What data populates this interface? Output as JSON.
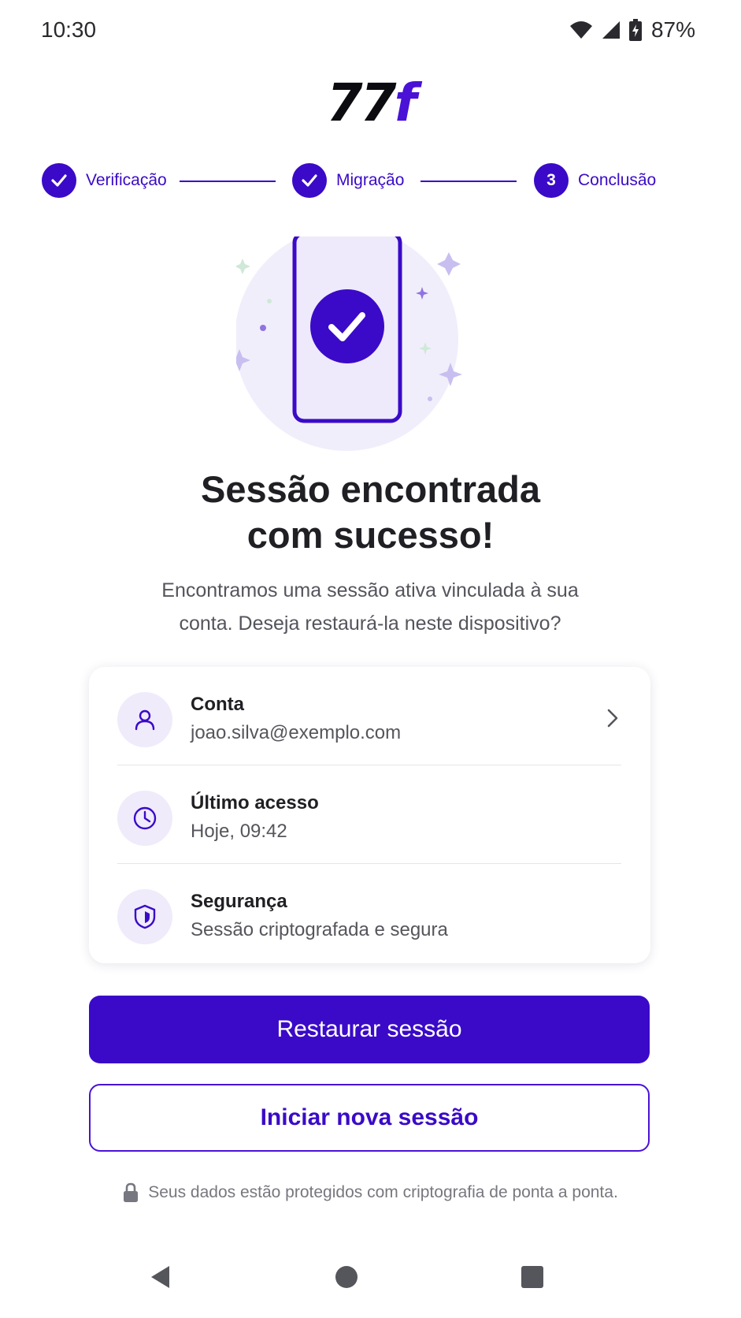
{
  "status_bar": {
    "time": "10:30",
    "battery": "87%"
  },
  "logo": {
    "number": "77",
    "letter": "f"
  },
  "stepper": {
    "steps": [
      {
        "label": "Verificação",
        "state": "done"
      },
      {
        "label": "Migração",
        "state": "done"
      },
      {
        "label": "Conclusão",
        "state": "current",
        "number": "3"
      }
    ]
  },
  "title_line1": "Sessão encontrada",
  "title_line2": "com sucesso!",
  "subtitle_line1": "Encontramos uma sessão ativa vinculada à sua",
  "subtitle_line2": "conta. Deseja restaurá-la neste dispositivo?",
  "info": {
    "account": {
      "label": "Conta",
      "value": "joao.silva@exemplo.com",
      "icon": "user-icon"
    },
    "last_access": {
      "label": "Último acesso",
      "value": "Hoje, 09:42",
      "icon": "clock-icon"
    },
    "security": {
      "label": "Segurança",
      "value": "Sessão criptografada e segura",
      "icon": "shield-icon"
    }
  },
  "buttons": {
    "restore": "Restaurar sessão",
    "new_session": "Iniciar nova sessão"
  },
  "footer_note": "Seus dados estão protegidos com criptografia de ponta a ponta.",
  "colors": {
    "primary": "#3a0ac8",
    "accent": "#4a12d6",
    "soft": "#efebfb"
  }
}
